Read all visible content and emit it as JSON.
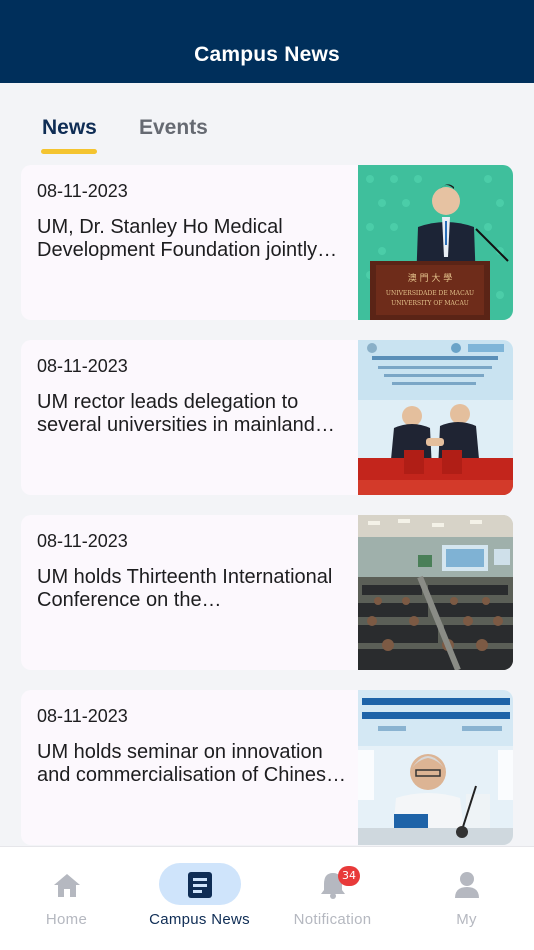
{
  "header": {
    "title": "Campus News"
  },
  "tabs": [
    {
      "label": "News",
      "active": true
    },
    {
      "label": "Events",
      "active": false
    }
  ],
  "news": [
    {
      "date": "08-11-2023",
      "title": "UM, Dr. Stanley Ho Medical Development Foundation jointly sign…",
      "thumb": "speaker-at-podium-photo"
    },
    {
      "date": "08-11-2023",
      "title": "UM rector leads delegation to several universities in mainland China",
      "thumb": "handshake-signing-photo"
    },
    {
      "date": "08-11-2023",
      "title": "UM holds Thirteenth International Conference on the…",
      "thumb": "conference-hall-photo"
    },
    {
      "date": "08-11-2023",
      "title": "UM holds seminar on innovation and commercialisation of Chinese medicine",
      "thumb": "seminar-speaker-photo"
    }
  ],
  "nav": {
    "items": [
      {
        "label": "Home",
        "icon": "home-icon",
        "active": false
      },
      {
        "label": "Campus News",
        "icon": "news-icon",
        "active": true
      },
      {
        "label": "Notification",
        "icon": "bell-icon",
        "active": false
      },
      {
        "label": "My",
        "icon": "person-icon",
        "active": false
      }
    ],
    "notification_badge": "34"
  },
  "colors": {
    "header": "#002f5b",
    "accent": "#f4c430",
    "active_pill": "#cfe4fb",
    "badge": "#e83a3a"
  }
}
